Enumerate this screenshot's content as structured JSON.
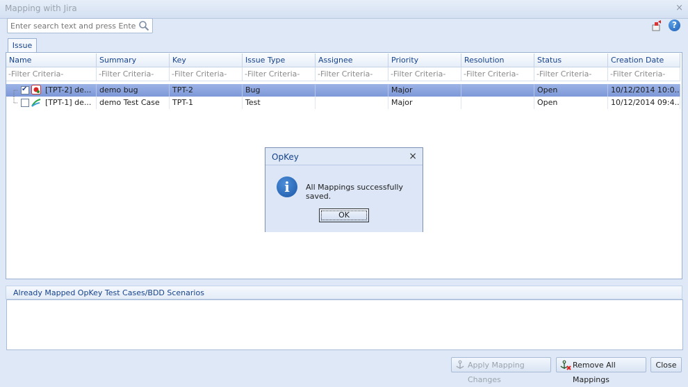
{
  "window": {
    "title": "Mapping with Jira"
  },
  "search": {
    "placeholder": "Enter search text and press Enter"
  },
  "tabs": [
    {
      "label": "Issue"
    }
  ],
  "grid": {
    "columns": [
      "Name",
      "Summary",
      "Key",
      "Issue Type",
      "Assignee",
      "Priority",
      "Resolution",
      "Status",
      "Creation Date"
    ],
    "filter_placeholder": "-Filter Criteria-",
    "rows": [
      {
        "checked": true,
        "selected": true,
        "name": "[TPT-2] de...",
        "summary": "demo bug",
        "key": "TPT-2",
        "issue_type": "Bug",
        "assignee": "",
        "priority": "Major",
        "resolution": "",
        "status": "Open",
        "creation_date": "10/12/2014 10:0..."
      },
      {
        "checked": false,
        "selected": false,
        "name": "[TPT-1] de...",
        "summary": "demo Test Case",
        "key": "TPT-1",
        "issue_type": "Test",
        "assignee": "",
        "priority": "Major",
        "resolution": "",
        "status": "Open",
        "creation_date": "10/12/2014 09:4..."
      }
    ]
  },
  "mapped_panel": {
    "title": "Already Mapped OpKey Test Cases/BDD Scenarios"
  },
  "buttons": {
    "apply": "Apply Mapping Changes",
    "remove_all": "Remove All Mappings",
    "close": "Close"
  },
  "dialog": {
    "title": "OpKey",
    "message": "All Mappings successfully saved.",
    "ok": "OK"
  },
  "colors": {
    "accent": "#15428b",
    "selected_row": "#8aa3de",
    "background": "#dfe8f6"
  }
}
